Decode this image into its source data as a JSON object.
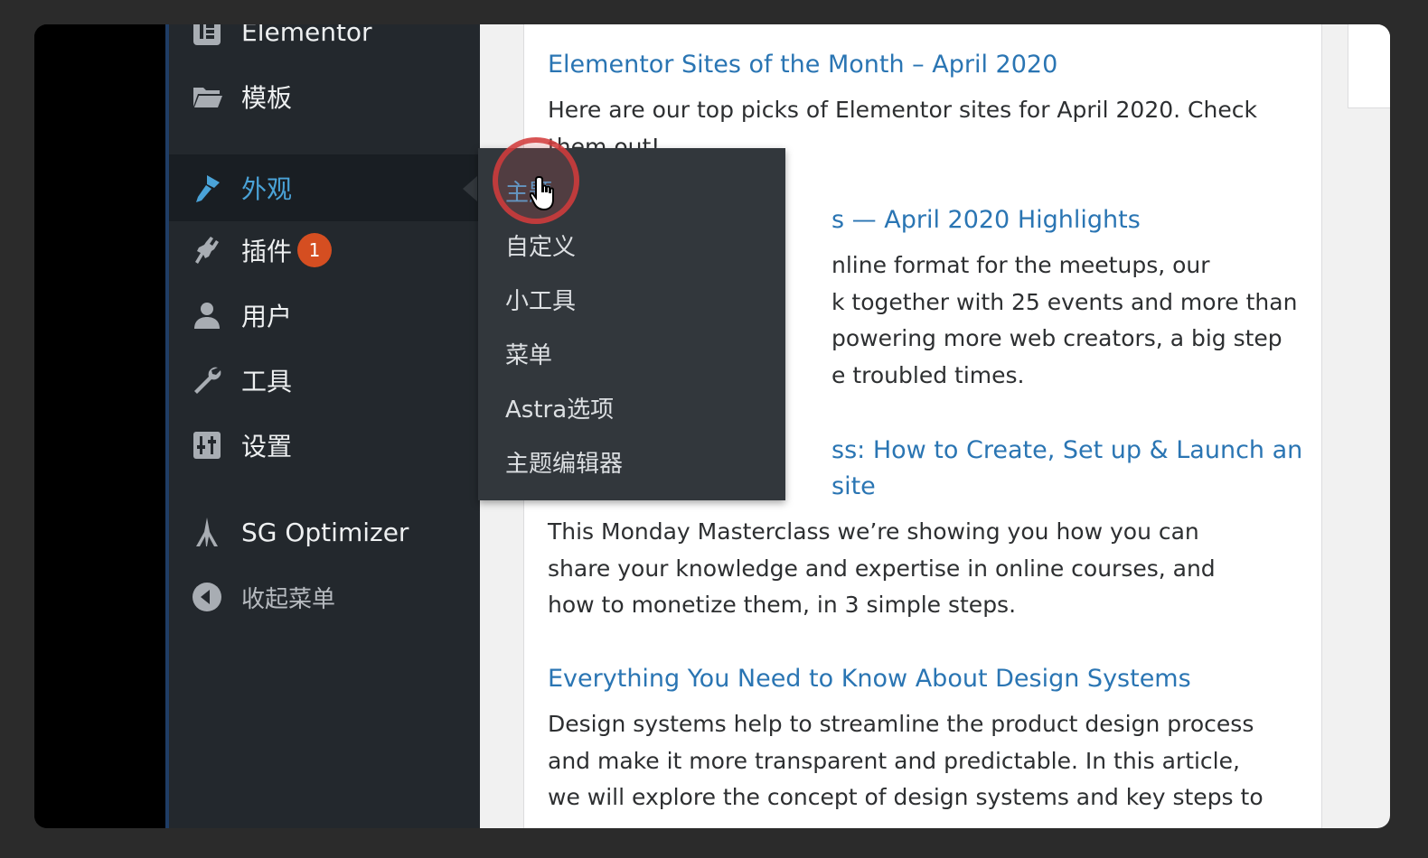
{
  "sidebar": {
    "items": [
      {
        "label": "Elementor",
        "icon": "elementor-icon"
      },
      {
        "label": "模板",
        "icon": "folder-icon"
      },
      {
        "label": "外观",
        "icon": "brush-icon",
        "active": true
      },
      {
        "label": "插件",
        "icon": "plugin-icon",
        "badge": "1"
      },
      {
        "label": "用户",
        "icon": "user-icon"
      },
      {
        "label": "工具",
        "icon": "wrench-icon"
      },
      {
        "label": "设置",
        "icon": "settings-icon"
      },
      {
        "label": "SG Optimizer",
        "icon": "sg-optimizer-icon"
      },
      {
        "label": "收起菜单",
        "icon": "collapse-icon"
      }
    ]
  },
  "submenu": {
    "items": [
      "主题",
      "自定义",
      "小工具",
      "菜单",
      "Astra选项",
      "主题编辑器"
    ],
    "current": "主题"
  },
  "posts": [
    {
      "title": "Elementor Sites of the Month – April 2020",
      "excerpt_lines": [
        "Here are our top picks of Elementor sites for April 2020. Check",
        "them out!"
      ]
    },
    {
      "title_visible": "s — April 2020 Highlights",
      "excerpt_lines": [
        "nline format for the meetups, our",
        "k together with 25 events and more than",
        "powering more web creators, a big step",
        "e troubled times."
      ]
    },
    {
      "title_lines": [
        "ss: How to Create, Set up & Launch an",
        "site"
      ],
      "excerpt_lines": [
        "This Monday Masterclass we’re showing you how you can",
        "share your knowledge and expertise in online courses, and",
        "how to monetize them, in 3 simple steps."
      ]
    },
    {
      "title": "Everything You Need to Know About Design Systems",
      "excerpt_lines": [
        "Design systems help to streamline the product design process",
        "and make it more transparent and predictable. In this article,",
        "we will explore the concept of design systems and key steps to"
      ]
    }
  ],
  "colors": {
    "sidebar_bg": "#23282d",
    "submenu_bg": "#32373c",
    "active_text": "#4aa3d8",
    "link": "#2a75b3",
    "badge": "#d54e21"
  }
}
